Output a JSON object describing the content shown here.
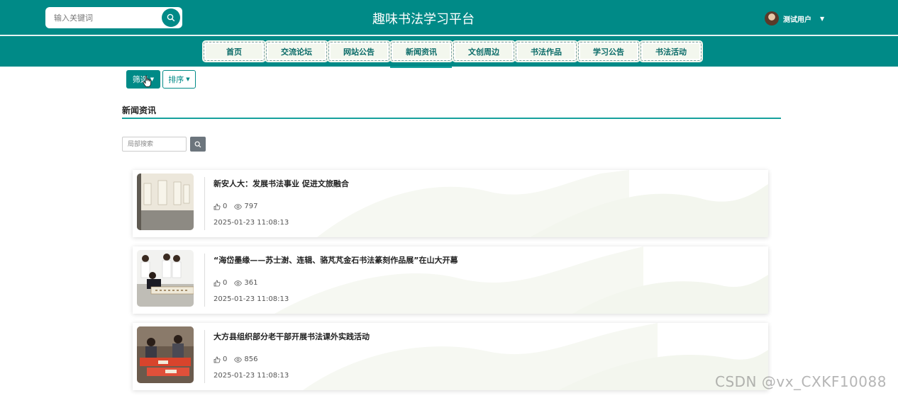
{
  "header": {
    "search_placeholder": "输入关键词",
    "site_title": "趣味书法学习平台",
    "username": "测试用户"
  },
  "nav": {
    "items": [
      {
        "label": "首页"
      },
      {
        "label": "交流论坛"
      },
      {
        "label": "网站公告"
      },
      {
        "label": "新闻资讯",
        "active": true
      },
      {
        "label": "文创周边"
      },
      {
        "label": "书法作品"
      },
      {
        "label": "学习公告"
      },
      {
        "label": "书法活动"
      }
    ]
  },
  "toolbar": {
    "filter_label": "筛选",
    "sort_label": "排序"
  },
  "section": {
    "title": "新闻资讯",
    "search_placeholder": "局部搜索"
  },
  "news": [
    {
      "title": "新安人大：发展书法事业 促进文旅融合",
      "likes": "0",
      "views": "797",
      "time": "2025-01-23 11:08:13"
    },
    {
      "title": "“海岱墨缘——苏士澍、连辑、骆芃芃金石书法篆刻作品展”在山大开幕",
      "likes": "0",
      "views": "361",
      "time": "2025-01-23 11:08:13"
    },
    {
      "title": "大方县组织部分老干部开展书法课外实践活动",
      "likes": "0",
      "views": "856",
      "time": "2025-01-23 11:08:13"
    }
  ],
  "watermark": "CSDN @vx_CXKF10088",
  "colors": {
    "primary": "#008a87",
    "accent": "#16a19d",
    "nav_bg": "#f3f7ee"
  }
}
